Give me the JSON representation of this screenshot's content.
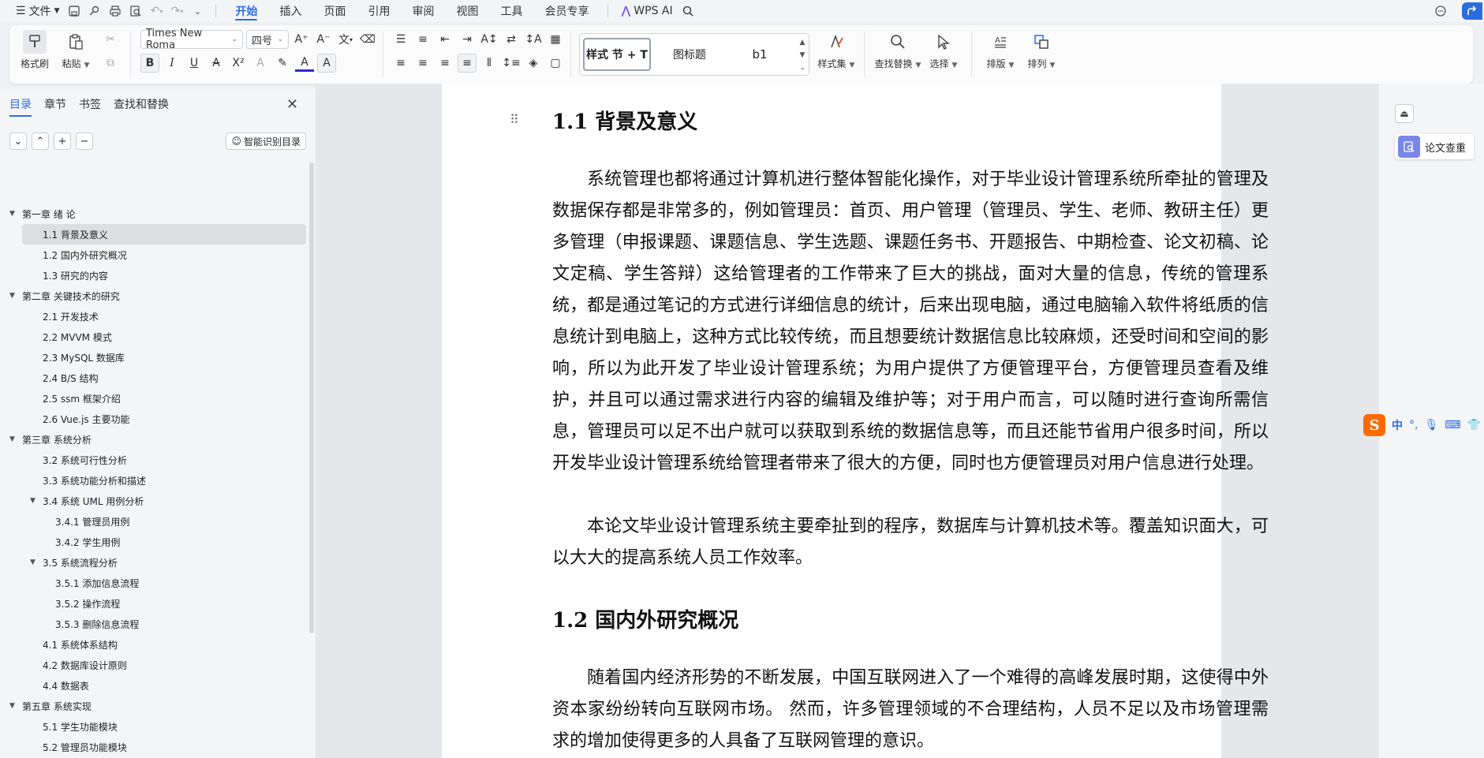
{
  "menubar": {
    "file_label": "文件",
    "tabs": [
      "开始",
      "插入",
      "页面",
      "引用",
      "审阅",
      "视图",
      "工具",
      "会员专享"
    ],
    "active_tab": "开始",
    "wps_ai_label": "WPS AI"
  },
  "ribbon": {
    "format_painter": "格式刷",
    "paste": "粘贴",
    "font_name": "Times New Roma",
    "font_size": "四号",
    "styles": [
      "样式 节 + T",
      "图标题",
      "b1"
    ],
    "style_set": "样式集",
    "find_replace": "查找替换",
    "select": "选择",
    "layout": "排版",
    "arrange": "排列",
    "bold": "B",
    "italic": "I",
    "underline": "U",
    "highlight_letter": "A"
  },
  "pane": {
    "tabs": [
      "目录",
      "章节",
      "书签",
      "查找和替换"
    ],
    "active_tab": "目录",
    "smart_toc_label": "智能识别目录",
    "toc": [
      {
        "label": "第一章  绪  论",
        "level": 0,
        "expanded": true
      },
      {
        "label": "1.1 背景及意义",
        "level": 1,
        "selected": true
      },
      {
        "label": "1.2 国内外研究概况",
        "level": 1
      },
      {
        "label": "1.3  研究的内容",
        "level": 1
      },
      {
        "label": "第二章  关键技术的研究",
        "level": 0,
        "expanded": true
      },
      {
        "label": "2.1  开发技术",
        "level": 1
      },
      {
        "label": "2.2 MVVM 模式",
        "level": 1
      },
      {
        "label": "2.3 MySQL 数据库",
        "level": 1
      },
      {
        "label": "2.4 B/S 结构",
        "level": 1
      },
      {
        "label": "2.5 ssm 框架介绍",
        "level": 1
      },
      {
        "label": "2.6 Vue.js  主要功能",
        "level": 1
      },
      {
        "label": "第三章  系统分析",
        "level": 0,
        "expanded": true
      },
      {
        "label": "3.2  系统可行性分析",
        "level": 1
      },
      {
        "label": "3.3  系统功能分析和描述",
        "level": 1
      },
      {
        "label": "3.4 系统 UML 用例分析",
        "level": 1,
        "expanded": true
      },
      {
        "label": "3.4.1 管理员用例",
        "level": 2
      },
      {
        "label": "3.4.2 学生用例",
        "level": 2
      },
      {
        "label": "3.5 系统流程分析",
        "level": 1,
        "expanded": true
      },
      {
        "label": "3.5.1 添加信息流程",
        "level": 2
      },
      {
        "label": "3.5.2 操作流程",
        "level": 2
      },
      {
        "label": "3.5.3 删除信息流程",
        "level": 2
      },
      {
        "label": "4.1  系统体系结构",
        "level": 1
      },
      {
        "label": "4.2  数据库设计原则",
        "level": 1
      },
      {
        "label": "4.4  数据表",
        "level": 1
      },
      {
        "label": "第五章  系统实现",
        "level": 0,
        "expanded": true
      },
      {
        "label": "5.1 学生功能模块",
        "level": 1
      },
      {
        "label": "5.2 管理员功能模块",
        "level": 1
      }
    ]
  },
  "document": {
    "heading1": "1.1 背景及意义",
    "para1": "系统管理也都将通过计算机进行整体智能化操作，对于毕业设计管理系统所牵扯的管理及数据保存都是非常多的，例如管理员：首页、用户管理（管理员、学生、老师、教研主任）更多管理（申报课题、课题信息、学生选题、课题任务书、开题报告、中期检查、论文初稿、论文定稿、学生答辩）这给管理者的工作带来了巨大的挑战，面对大量的信息，传统的管理系统，都是通过笔记的方式进行详细信息的统计，后来出现电脑，通过电脑输入软件将纸质的信息统计到电脑上，这种方式比较传统，而且想要统计数据信息比较麻烦，还受时间和空间的影响，所以为此开发了毕业设计管理系统；为用户提供了方便管理平台，方便管理员查看及维护，并且可以通过需求进行内容的编辑及维护等；对于用户而言，可以随时进行查询所需信息，管理员可以足不出户就可以获取到系统的数据信息等，而且还能节省用户很多时间，所以开发毕业设计管理系统给管理者带来了很大的方便，同时也方便管理员对用户信息进行处理。",
    "para2": "本论文毕业设计管理系统主要牵扯到的程序，数据库与计算机技术等。覆盖知识面大，可以大大的提高系统人员工作效率。",
    "heading2": "1.2 国内外研究概况",
    "para3": "随着国内经济形势的不断发展，中国互联网进入了一个难得的高峰发展时期，这使得中外资本家纷纷转向互联网市场。 然而，许多管理领域的不合理结构，人员不足以及市场管理需求的增加使得更多的人具备了互联网管理的意识。"
  },
  "rightrail": {
    "paper_check_label": "论文查重"
  },
  "ime": {
    "logo": "S",
    "mode": "中",
    "punct": "°,"
  },
  "colors": {
    "accent": "#2b6de0",
    "ime_orange": "#ff6a00",
    "check_icon": "#7a86e8"
  }
}
